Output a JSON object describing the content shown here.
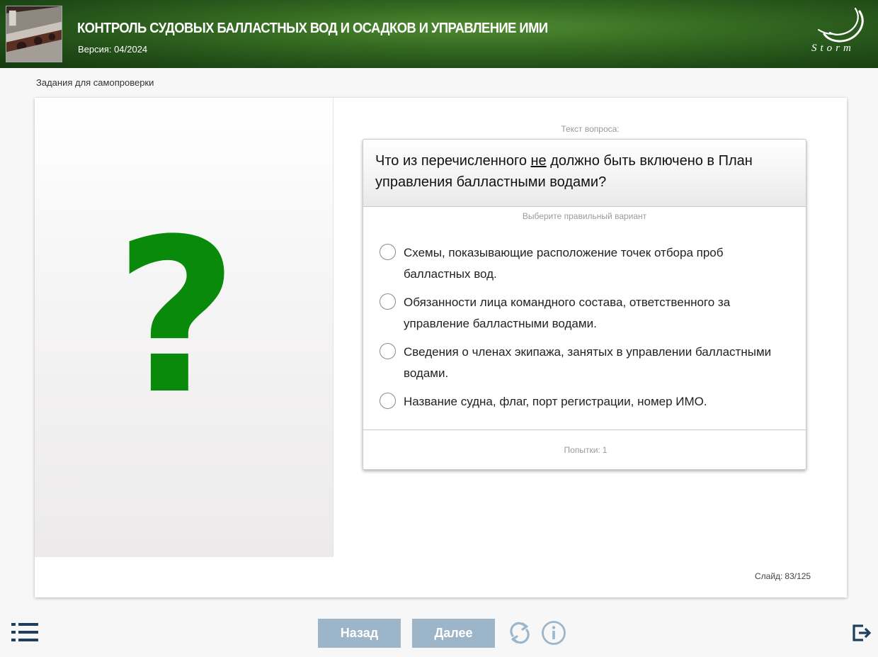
{
  "header": {
    "title": "КОНТРОЛЬ СУДОВЫХ БАЛЛАСТНЫХ ВОД И ОСАДКОВ И УПРАВЛЕНИЕ ИМИ",
    "version": "Версия: 04/2024",
    "logo_text": "Storm",
    "thumbnail_icon": "ship-image"
  },
  "section_label": "Задания для самопроверки",
  "left_panel": {
    "symbol": "?",
    "symbol_color": "#0a8a0a"
  },
  "question": {
    "label": "Текст вопроса:",
    "text_before": "Что из перечисленного ",
    "text_emphasis": "не",
    "text_after": " должно быть включено в План управления балластными водами?",
    "choose_label": "Выберите правильный вариант",
    "options": [
      {
        "text": "Схемы, показывающие расположение точек отбора проб балластных вод."
      },
      {
        "text": "Обязанности лица командного состава, ответственного за управление балластными водами."
      },
      {
        "text": "Сведения о членах экипажа, занятых в управлении балластными водами."
      },
      {
        "text": "Название судна, флаг, порт регистрации, номер ИМО."
      }
    ],
    "attempts_label": "Попытки:",
    "attempts_value": "1"
  },
  "slide_counter": {
    "label": "Слайд:",
    "value": "83/125"
  },
  "nav": {
    "back_label": "Назад",
    "next_label": "Далее",
    "button_color": "#9db5c9",
    "icons": [
      "menu-icon",
      "refresh-icon",
      "info-icon",
      "exit-icon"
    ]
  },
  "colors": {
    "header_green": "#356b22",
    "accent_blue": "#9db5c9",
    "icon_dark": "#1e3f5f"
  }
}
